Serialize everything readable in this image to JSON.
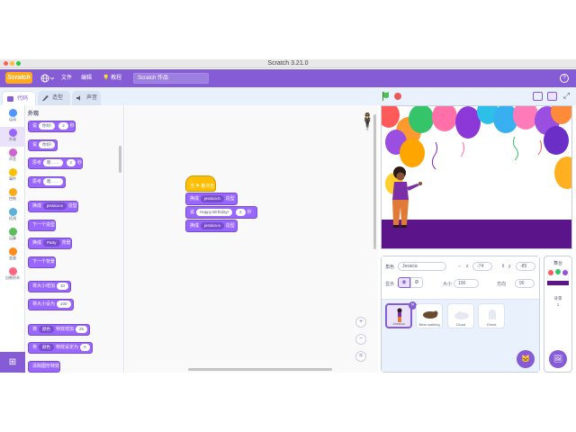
{
  "window": {
    "title": "Scratch 3.21.0"
  },
  "menubar": {
    "logo": "Scratch",
    "items": [
      "",
      "文件",
      "编辑",
      "教程"
    ],
    "project_title": "Scratch 作品",
    "help": "?"
  },
  "tabs": [
    {
      "label": "代码"
    },
    {
      "label": "造型"
    },
    {
      "label": "声音"
    }
  ],
  "categories": [
    {
      "label": "运动",
      "color": "#4c97ff"
    },
    {
      "label": "外观",
      "color": "#9966ff"
    },
    {
      "label": "声音",
      "color": "#cf63cf"
    },
    {
      "label": "事件",
      "color": "#ffbf00"
    },
    {
      "label": "控制",
      "color": "#ffab19"
    },
    {
      "label": "侦测",
      "color": "#5cb1d6"
    },
    {
      "label": "运算",
      "color": "#59c059"
    },
    {
      "label": "变量",
      "color": "#ff8c1a"
    },
    {
      "label": "自制积木",
      "color": "#ff6680"
    }
  ],
  "palette": {
    "heading": "外观",
    "blocks": [
      {
        "text": "说",
        "slot1": "你好!",
        "mid": "",
        "slot2": "2",
        "tail": "秒"
      },
      {
        "text": "说",
        "slot1": "你好!",
        "mid": "",
        "slot2": "",
        "tail": ""
      },
      {
        "text": "思考",
        "slot1": "嗯……",
        "mid": "",
        "slot2": "2",
        "tail": "秒"
      },
      {
        "text": "思考",
        "slot1": "嗯……",
        "mid": "",
        "slot2": "",
        "tail": ""
      },
      {
        "text": "换成",
        "slot1": "jessica-a",
        "mid": "",
        "slot2": "",
        "tail": "造型"
      },
      {
        "text": "下一个造型",
        "slot1": "",
        "mid": "",
        "slot2": "",
        "tail": ""
      },
      {
        "text": "换成",
        "slot1": "Party",
        "mid": "",
        "slot2": "",
        "tail": "背景"
      },
      {
        "text": "下一个背景",
        "slot1": "",
        "mid": "",
        "slot2": "",
        "tail": ""
      },
      {
        "text": "将大小增加",
        "slot1": "10",
        "mid": "",
        "slot2": "",
        "tail": ""
      },
      {
        "text": "将大小设为",
        "slot1": "100",
        "mid": "",
        "slot2": "",
        "tail": ""
      },
      {
        "text": "将",
        "slot1": "颜色",
        "mid": "特效增加",
        "slot2": "25",
        "tail": ""
      },
      {
        "text": "将",
        "slot1": "颜色",
        "mid": "特效设定为",
        "slot2": "0",
        "tail": ""
      },
      {
        "text": "清除图形特效",
        "slot1": "",
        "mid": "",
        "slot2": "",
        "tail": ""
      }
    ]
  },
  "script": {
    "hat": "当 ⚑ 被点击",
    "blocks": [
      {
        "text": "换成",
        "slot1": "jessica-b",
        "slot2": "",
        "tail": "造型"
      },
      {
        "text": "说",
        "slot1": "Happy Birthday!",
        "slot2": "2",
        "tail": "秒"
      },
      {
        "text": "换成",
        "slot1": "jessica-a",
        "slot2": "",
        "tail": "造型"
      }
    ],
    "zoom_in": "+",
    "zoom_out": "−",
    "zoom_reset": "="
  },
  "sprite_info": {
    "sprite_label": "角色",
    "sprite_name": "Jessica",
    "x_label": "x",
    "x_value": "-74",
    "y_label": "y",
    "y_value": "-85",
    "show_label": "显示",
    "size_label": "大小",
    "size_value": "100",
    "direction_label": "方向",
    "direction_value": "90"
  },
  "sprites": [
    {
      "name": "Jessica",
      "selected": true
    },
    {
      "name": "Bear-walking",
      "selected": false
    },
    {
      "name": "Cloud",
      "selected": false
    },
    {
      "name": "Ghost",
      "selected": false
    }
  ],
  "backdrop_panel": {
    "label": "舞台",
    "backdrops_label": "背景",
    "backdrop_count": "1"
  },
  "colors": {
    "menubar": "#855cd6",
    "looks": "#9966ff",
    "events": "#ffbf00",
    "stage_floor": "#5b148a"
  }
}
